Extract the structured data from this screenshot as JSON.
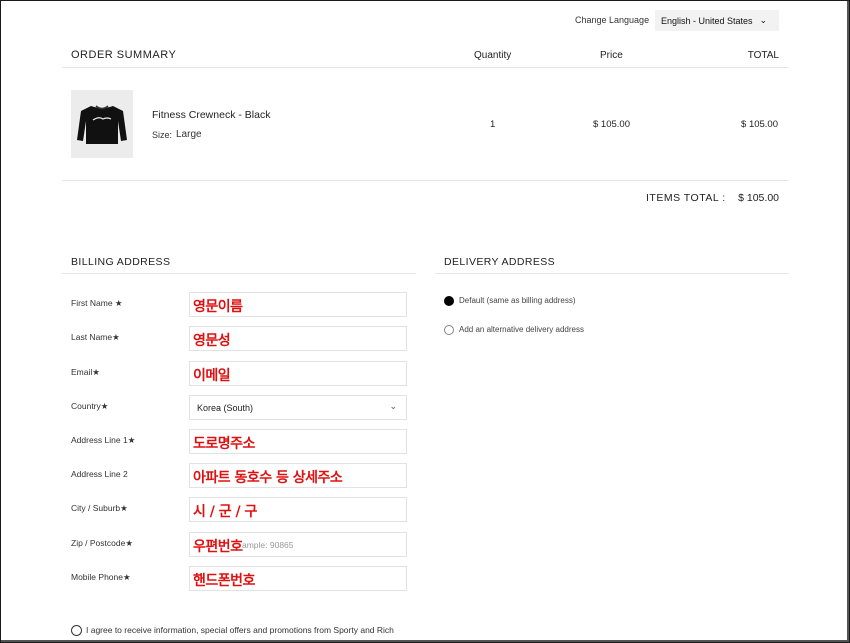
{
  "language": {
    "label": "Change Language",
    "selected": "English - United States",
    "chevron_icon": "chevron-down-icon"
  },
  "summary": {
    "title": "ORDER SUMMARY",
    "col_quantity": "Quantity",
    "col_price": "Price",
    "col_total": "TOTAL",
    "items": [
      {
        "name": "Fitness Crewneck - Black",
        "size_label": "Size:",
        "size": "Large",
        "quantity": "1",
        "price": "$ 105.00",
        "total": "$ 105.00",
        "image_icon": "black-crewneck-sweatshirt-image"
      }
    ],
    "items_total_label": "ITEMS TOTAL :",
    "items_total_value": "$ 105.00"
  },
  "billing": {
    "title": "BILLING ADDRESS",
    "fields": [
      {
        "label": "First Name ★",
        "value": "영문이름"
      },
      {
        "label": "Last Name★",
        "value": "영문성"
      },
      {
        "label": "Email★",
        "value": "이메일"
      },
      {
        "label": "Country★",
        "value": "Korea (South)"
      },
      {
        "label": "Address Line 1★",
        "value": "도로명주소"
      },
      {
        "label": "Address Line 2",
        "value": "아파트 동호수 등 상세주소"
      },
      {
        "label": "City / Suburb★",
        "value": "시 / 군 / 구"
      },
      {
        "label": "Zip / Postcode★",
        "value": "우편번호",
        "placeholder": "ample: 90865"
      },
      {
        "label": "Mobile Phone★",
        "value": "핸드폰번호"
      }
    ]
  },
  "delivery": {
    "title": "DELIVERY ADDRESS",
    "options": [
      {
        "label": "Default (same as billing address)",
        "selected": true
      },
      {
        "label": "Add an alternative delivery address",
        "selected": false
      }
    ]
  },
  "agree": {
    "text": "I agree to receive information, special offers and promotions from Sporty and Rich"
  },
  "colors": {
    "annotation_red": "#e01010",
    "divider": "#e6e6e6",
    "lang_bg": "#f2f2f2"
  }
}
